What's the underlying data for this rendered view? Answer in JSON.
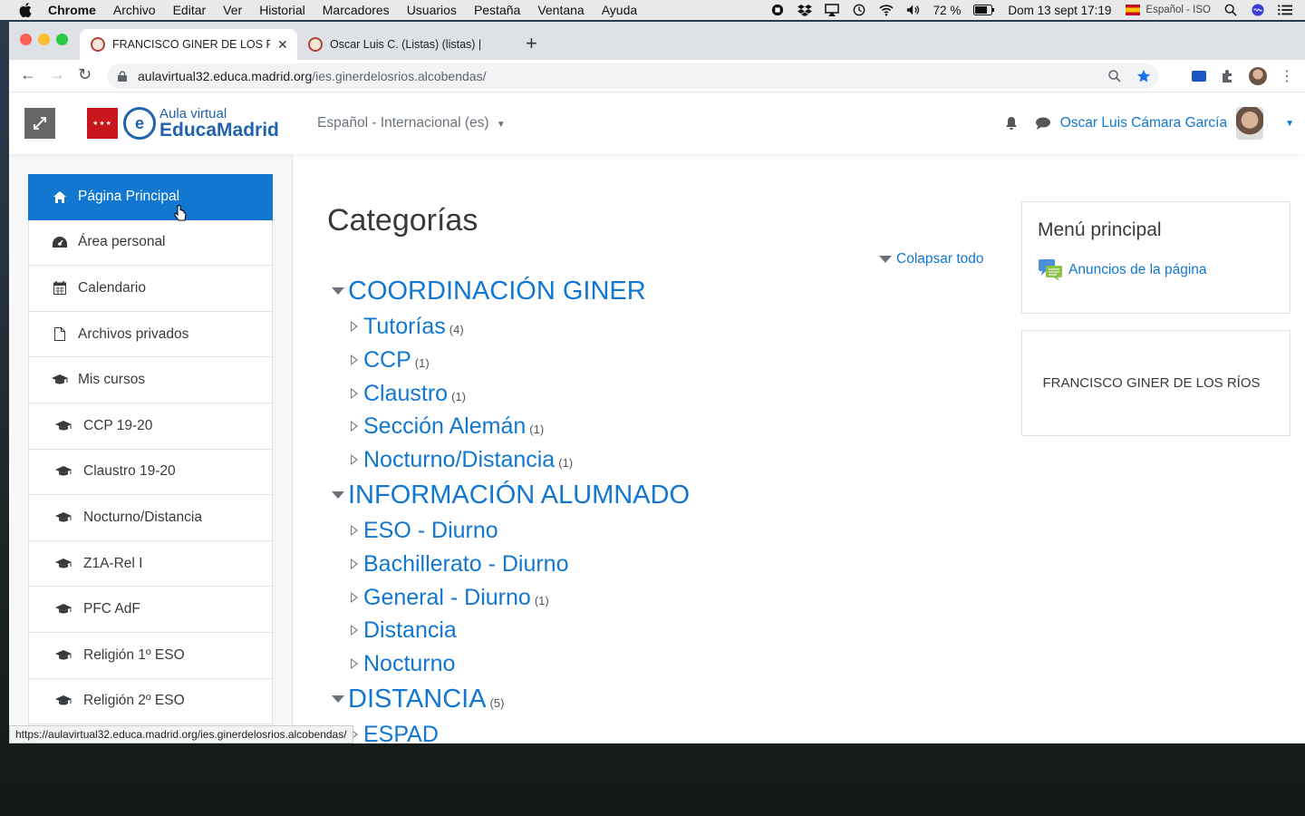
{
  "menubar": {
    "items": [
      "Chrome",
      "Archivo",
      "Editar",
      "Ver",
      "Historial",
      "Marcadores",
      "Usuarios",
      "Pestaña",
      "Ventana",
      "Ayuda"
    ],
    "battery": "72 %",
    "datetime": "Dom 13 sept  17:19",
    "input_source": "Español - ISO"
  },
  "browser": {
    "tabs": [
      {
        "title": "FRANCISCO GINER DE LOS RÍOS",
        "active": true
      },
      {
        "title": "Oscar Luis C. (Listas) (listas) |",
        "active": false
      }
    ],
    "url_host": "aulavirtual32.educa.madrid.org",
    "url_path": "/ies.ginerdelosrios.alcobendas/",
    "status_url": "https://aulavirtual32.educa.madrid.org/ies.ginerdelosrios.alcobendas/"
  },
  "header": {
    "logo_small": "Aula virtual",
    "logo_big": "EducaMadrid",
    "language": "Español - Internacional (es)",
    "user_name": "Oscar Luis Cámara García"
  },
  "nav": {
    "items": [
      {
        "label": "Página Principal",
        "icon": "home-icon",
        "active": true
      },
      {
        "label": "Área personal",
        "icon": "dashboard-icon"
      },
      {
        "label": "Calendario",
        "icon": "calendar-icon"
      },
      {
        "label": "Archivos privados",
        "icon": "file-icon"
      },
      {
        "label": "Mis cursos",
        "icon": "graduation-cap-icon"
      },
      {
        "label": "CCP 19-20",
        "icon": "graduation-cap-icon",
        "sub": true
      },
      {
        "label": "Claustro 19-20",
        "icon": "graduation-cap-icon",
        "sub": true
      },
      {
        "label": "Nocturno/Distancia",
        "icon": "graduation-cap-icon",
        "sub": true
      },
      {
        "label": "Z1A-Rel I",
        "icon": "graduation-cap-icon",
        "sub": true
      },
      {
        "label": "PFC AdF",
        "icon": "graduation-cap-icon",
        "sub": true
      },
      {
        "label": "Religión 1º ESO",
        "icon": "graduation-cap-icon",
        "sub": true
      },
      {
        "label": "Religión 2º ESO",
        "icon": "graduation-cap-icon",
        "sub": true
      }
    ]
  },
  "main": {
    "title": "Categorías",
    "collapse_all": "Colapsar todo",
    "categories": [
      {
        "name": "COORDINACIÓN GINER",
        "count": "",
        "children": [
          {
            "name": "Tutorías",
            "count": "(4)"
          },
          {
            "name": "CCP",
            "count": "(1)"
          },
          {
            "name": "Claustro",
            "count": "(1)"
          },
          {
            "name": "Sección Alemán",
            "count": "(1)"
          },
          {
            "name": "Nocturno/Distancia",
            "count": "(1)"
          }
        ]
      },
      {
        "name": "INFORMACIÓN ALUMNADO",
        "count": "",
        "children": [
          {
            "name": "ESO - Diurno",
            "count": ""
          },
          {
            "name": "Bachillerato - Diurno",
            "count": ""
          },
          {
            "name": "General - Diurno",
            "count": "(1)"
          },
          {
            "name": "Distancia",
            "count": ""
          },
          {
            "name": "Nocturno",
            "count": ""
          }
        ]
      },
      {
        "name": "DISTANCIA",
        "count": "(5)",
        "children": [
          {
            "name": "ESPAD",
            "count": ""
          }
        ]
      }
    ]
  },
  "blocks": {
    "main_menu_title": "Menú principal",
    "announcements_link": "Anuncios de la página",
    "school_name": "FRANCISCO GINER DE LOS RÍOS"
  }
}
